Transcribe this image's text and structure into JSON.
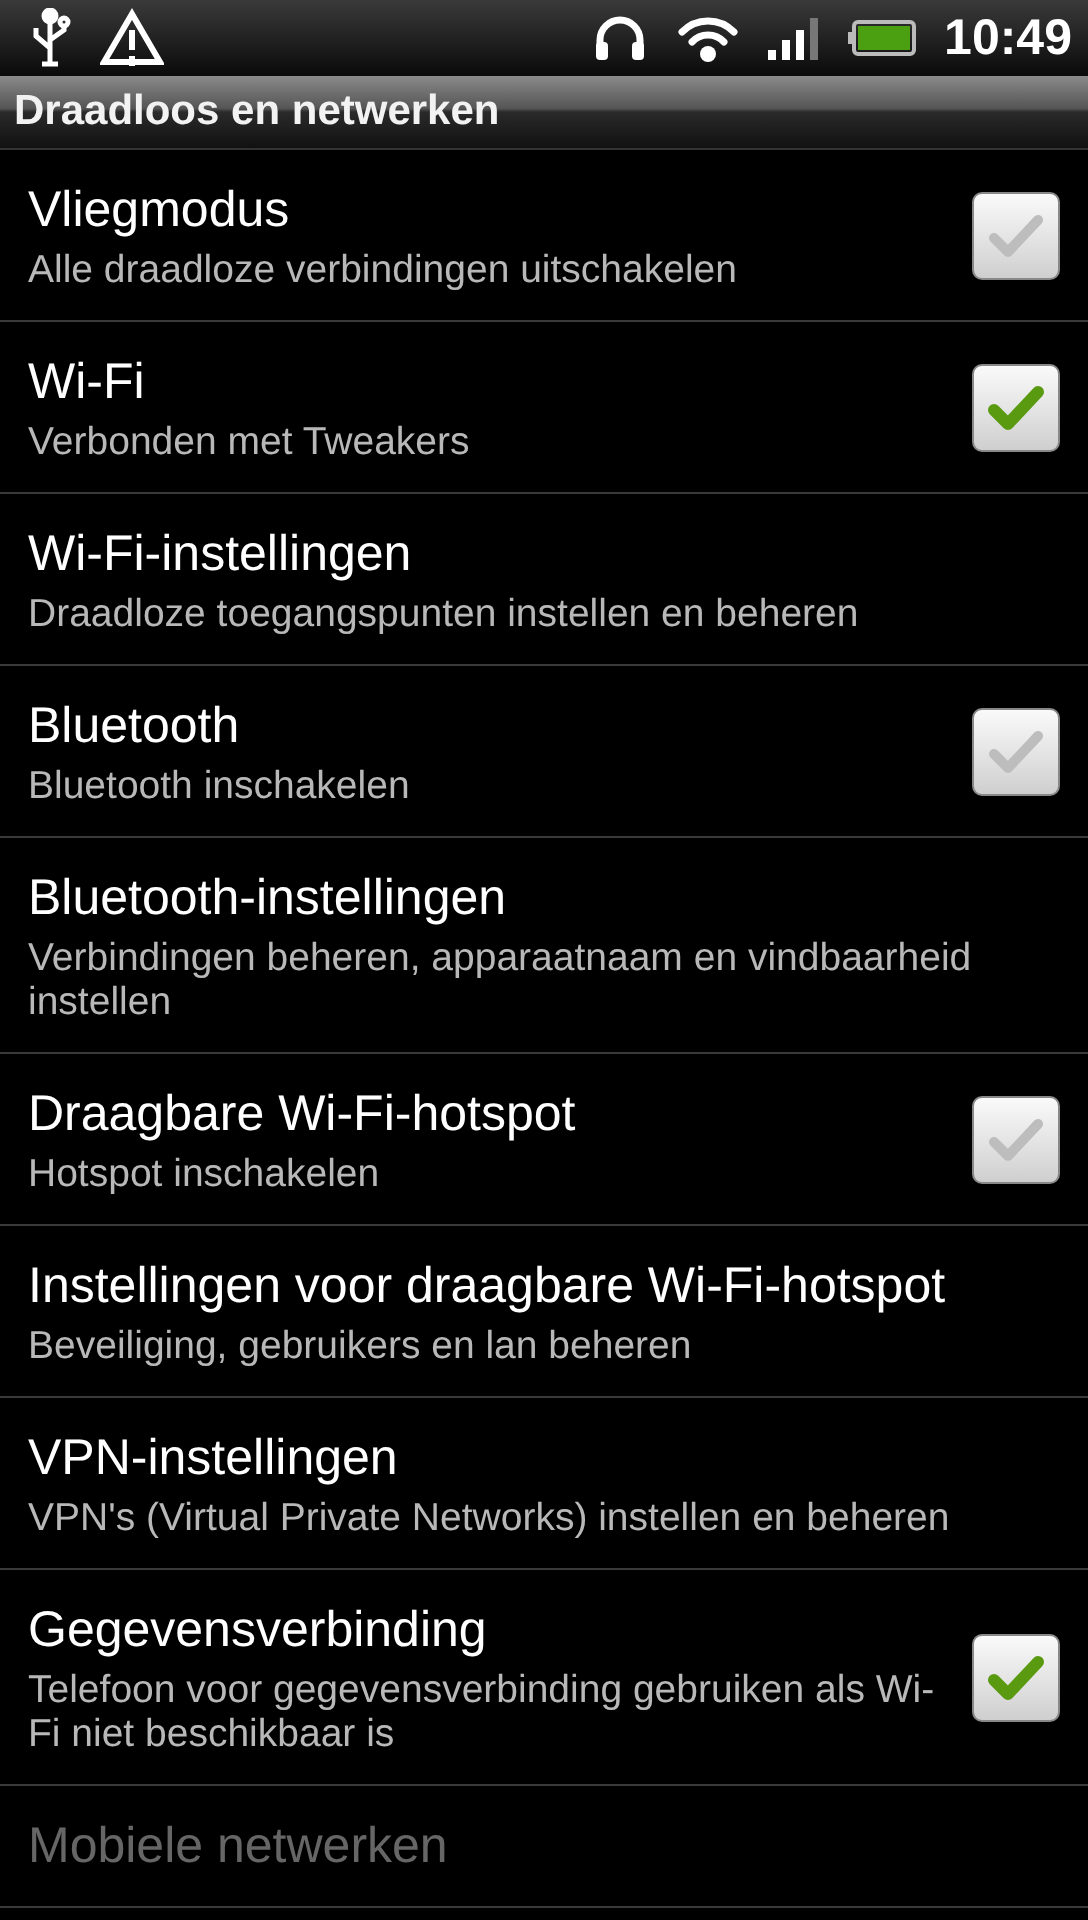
{
  "status_bar": {
    "time": "10:49"
  },
  "header": {
    "title": "Draadloos en netwerken"
  },
  "items": [
    {
      "kind": "checkbox",
      "title": "Vliegmodus",
      "summary": "Alle draadloze verbindingen uitschakelen",
      "checked": false,
      "disabled": false
    },
    {
      "kind": "checkbox",
      "title": "Wi-Fi",
      "summary": "Verbonden met Tweakers",
      "checked": true,
      "disabled": false
    },
    {
      "kind": "link",
      "title": "Wi-Fi-instellingen",
      "summary": "Draadloze toegangspunten instellen en beheren",
      "disabled": false
    },
    {
      "kind": "checkbox",
      "title": "Bluetooth",
      "summary": "Bluetooth inschakelen",
      "checked": false,
      "disabled": false
    },
    {
      "kind": "link",
      "title": "Bluetooth-instellingen",
      "summary": "Verbindingen beheren, apparaatnaam en vindbaarheid instellen",
      "disabled": false
    },
    {
      "kind": "checkbox",
      "title": "Draagbare Wi-Fi-hotspot",
      "summary": "Hotspot inschakelen",
      "checked": false,
      "disabled": false
    },
    {
      "kind": "link",
      "title": "Instellingen voor draagbare Wi-Fi-hotspot",
      "summary": "Beveiliging, gebruikers en lan beheren",
      "disabled": false
    },
    {
      "kind": "link",
      "title": "VPN-instellingen",
      "summary": "VPN's (Virtual Private Networks) instellen en beheren",
      "disabled": false
    },
    {
      "kind": "checkbox",
      "title": "Gegevensverbinding",
      "summary": "Telefoon voor gegevensverbinding gebruiken als Wi-Fi niet beschikbaar is",
      "checked": true,
      "disabled": false
    },
    {
      "kind": "link",
      "title": "Mobiele netwerken",
      "disabled": true
    }
  ]
}
